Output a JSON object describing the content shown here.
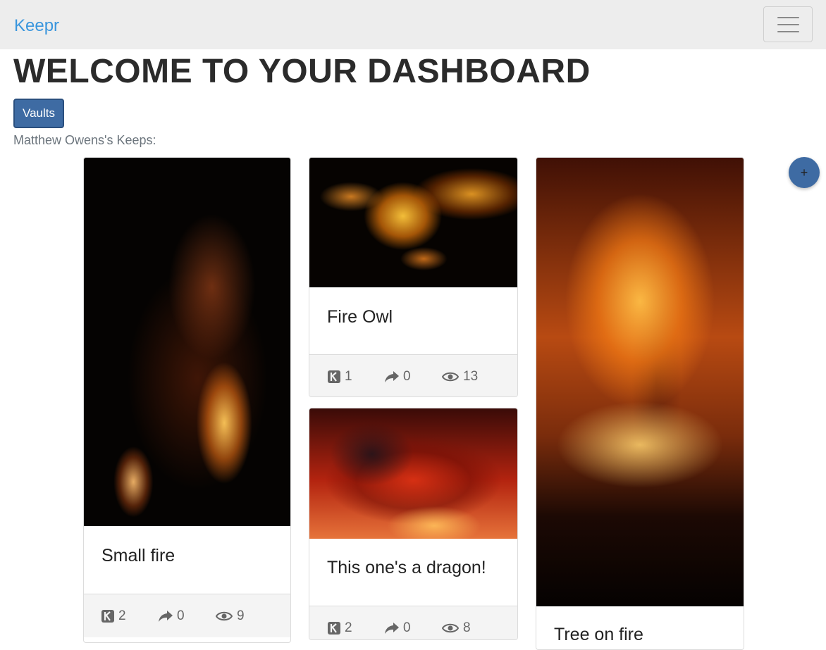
{
  "navbar": {
    "brand": "Keepr",
    "menu_icon": "hamburger-icon"
  },
  "page": {
    "title": "WELCOME TO YOUR DASHBOARD",
    "vaults_button": "Vaults",
    "owner_label": "Matthew Owens's Keeps:",
    "add_button": "+"
  },
  "keeps": [
    {
      "title": "Small fire",
      "keeps": "2",
      "shares": "0",
      "views": "9"
    },
    {
      "title": "Fire Owl",
      "keeps": "1",
      "shares": "0",
      "views": "13"
    },
    {
      "title": "This one's a dragon!",
      "keeps": "2",
      "shares": "0",
      "views": "8"
    },
    {
      "title": "Tree on fire"
    }
  ],
  "icons": {
    "keep": "keepr-k-icon",
    "share": "share-arrow-icon",
    "views": "eye-icon"
  },
  "colors": {
    "brand": "#3a96dd",
    "primary": "#3e6ba3",
    "navbar_bg": "#ededed"
  }
}
